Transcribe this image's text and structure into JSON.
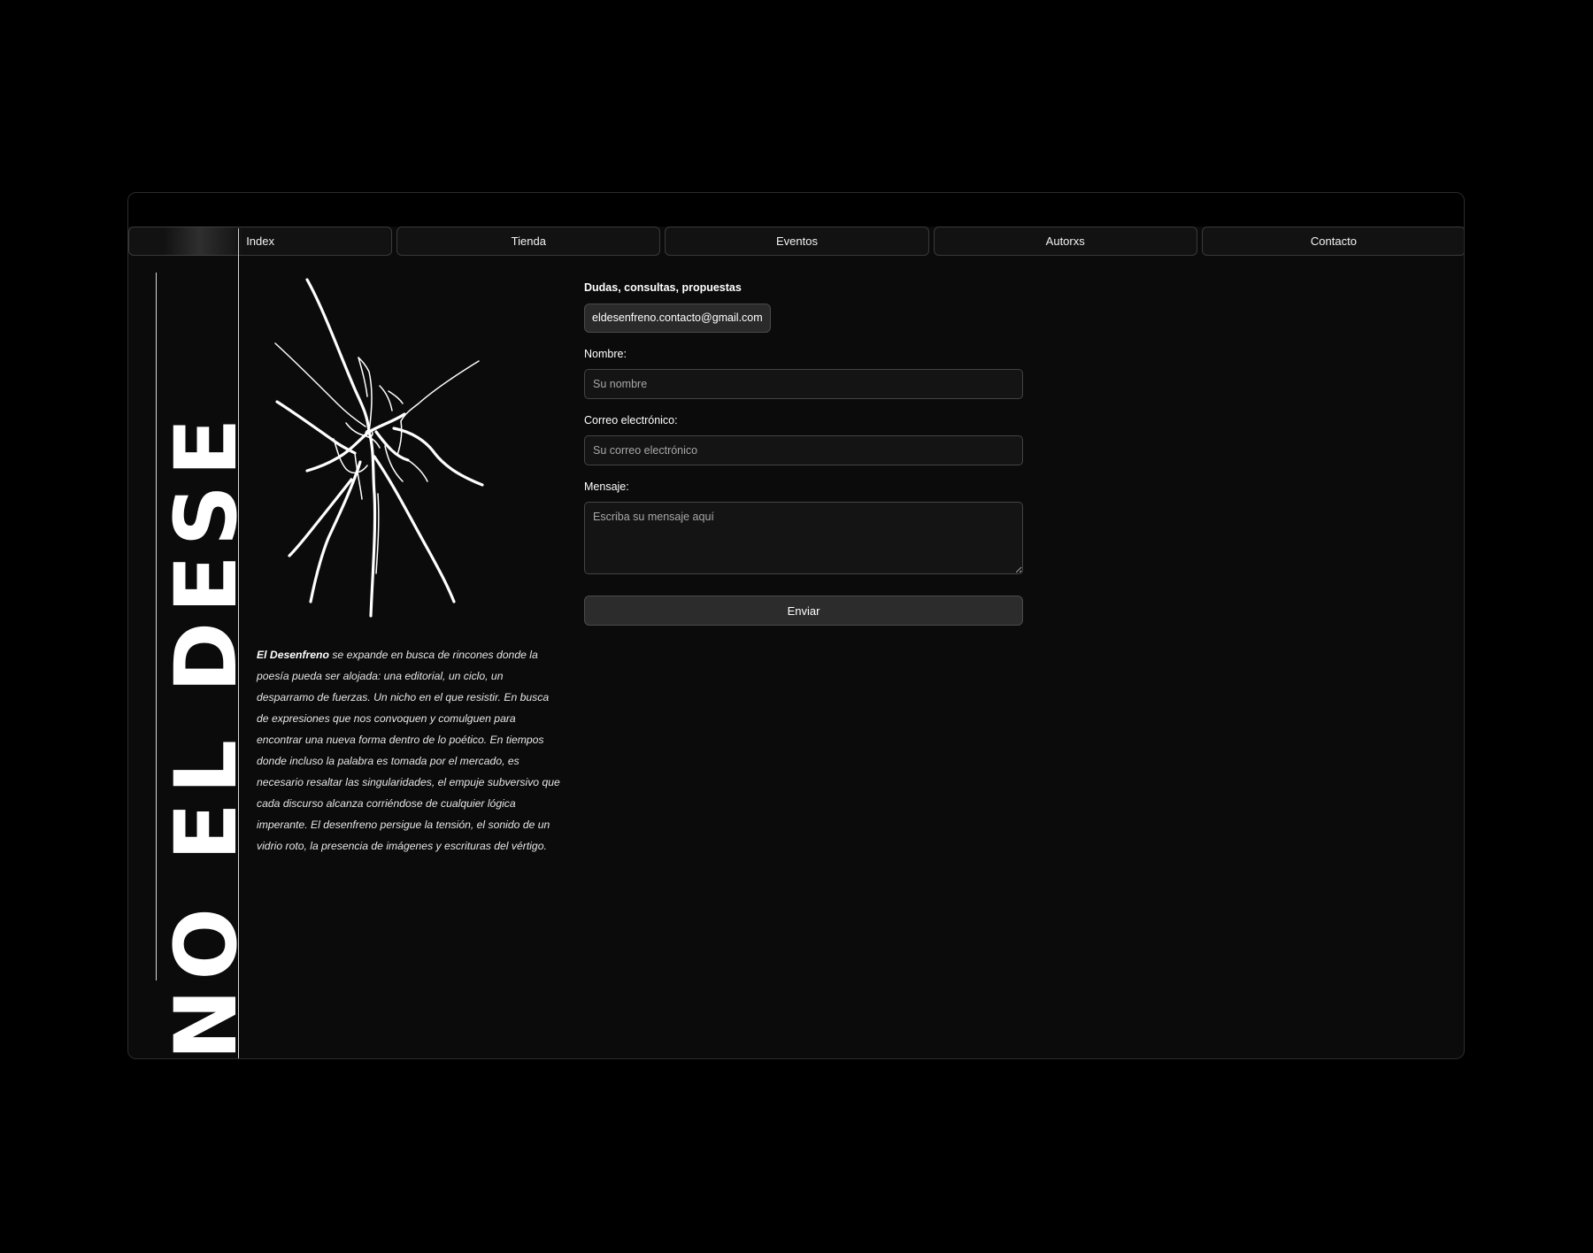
{
  "nav": {
    "items": [
      {
        "label": "Index"
      },
      {
        "label": "Tienda"
      },
      {
        "label": "Eventos"
      },
      {
        "label": "Autorxs"
      },
      {
        "label": "Contacto"
      }
    ]
  },
  "sidebar": {
    "vertical_title": "NO EL DESE"
  },
  "intro": {
    "brand": "El Desenfreno",
    "text": " se expande en busca de rincones donde la poesía pueda ser alojada: una editorial, un ciclo, un desparramo de fuerzas. Un nicho en el que resistir. En busca de expresiones que nos convoquen y comulguen para encontrar una nueva forma dentro de lo poético. En tiempos donde incluso la palabra es tomada por el mercado, es necesario resaltar las singularidades, el empuje subversivo que cada discurso alcanza corriéndose de cualquier lógica imperante. El desenfreno persigue la tensión, el sonido de un vidrio roto, la presencia de imágenes y escrituras del vértigo."
  },
  "contact": {
    "heading": "Dudas, consultas, propuestas",
    "email": "eldesenfreno.contacto@gmail.com",
    "name_label": "Nombre:",
    "name_placeholder": "Su nombre",
    "email_label": "Correo electrónico:",
    "email_placeholder": "Su correo electrónico",
    "message_label": "Mensaje:",
    "message_placeholder": "Escriba su mensaje aquí",
    "submit_label": "Enviar"
  },
  "colors": {
    "page_background": "#000000",
    "panel_background": "#0b0b0b",
    "text": "#ffffff"
  },
  "icons": {
    "illustration": "broken-glass-icon"
  }
}
